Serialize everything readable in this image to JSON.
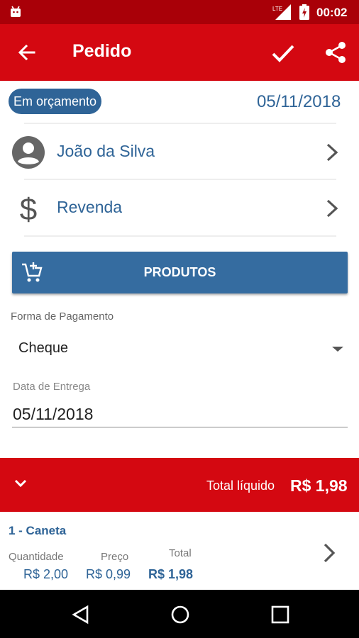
{
  "status_bar": {
    "time": "00:02",
    "network": "LTE",
    "icons": [
      "android-icon",
      "signal-icon",
      "battery-icon"
    ]
  },
  "app_bar": {
    "title": "Pedido",
    "icons": [
      "back-arrow-icon",
      "check-icon",
      "share-icon"
    ]
  },
  "order": {
    "status": "Em orçamento",
    "date": "05/11/2018"
  },
  "customer": {
    "name": "João da Silva",
    "icon": "person-icon"
  },
  "price_table": {
    "name": "Revenda",
    "icon": "dollar-icon"
  },
  "products_button": {
    "label": "PRODUTOS",
    "icon": "add-cart-icon"
  },
  "payment": {
    "label": "Forma de Pagamento",
    "value": "Cheque"
  },
  "delivery": {
    "label": "Data de Entrega",
    "value": "05/11/2018"
  },
  "totals": {
    "label": "Total líquido",
    "value": "R$ 1,98"
  },
  "items": [
    {
      "title": "1 - Caneta",
      "quantity_label": "Quantidade",
      "quantity": "R$ 2,00",
      "price_label": "Preço",
      "price": "R$ 0,99",
      "total_label": "Total",
      "total": "R$ 1,98"
    }
  ],
  "colors": {
    "primary_red": "#d40811",
    "status_red": "#a90008",
    "accent_blue": "#2f6497",
    "button_blue": "#356ca0"
  }
}
